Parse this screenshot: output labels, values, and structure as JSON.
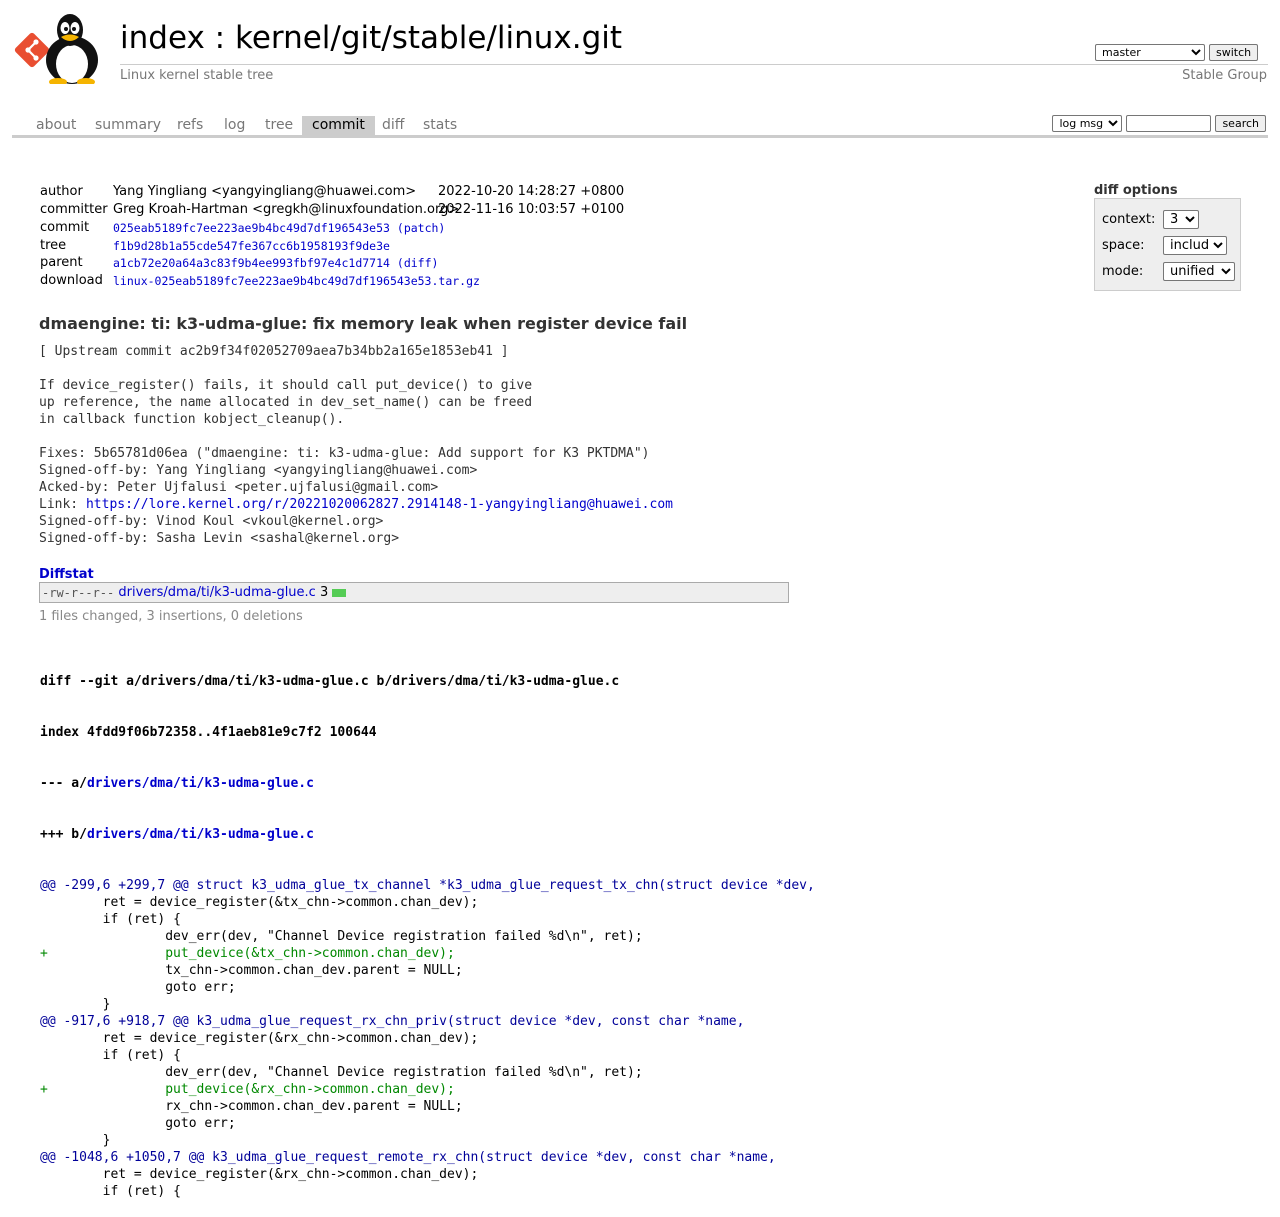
{
  "header": {
    "title_index": "index",
    "title_sep": " : ",
    "title_repo": "kernel/git/stable/linux.git",
    "description": "Linux kernel stable tree",
    "owner": "Stable Group",
    "branch_selected": "master",
    "switch_label": "switch"
  },
  "tabs": [
    "about",
    "summary",
    "refs",
    "log",
    "tree",
    "commit",
    "diff",
    "stats"
  ],
  "active_tab": "commit",
  "search": {
    "type_selected": "log msg",
    "button_label": "search",
    "value": ""
  },
  "diff_options": {
    "title": "diff options",
    "context_label": "context:",
    "context_value": "3",
    "space_label": "space:",
    "space_value": "include",
    "mode_label": "mode:",
    "mode_value": "unified"
  },
  "commit_info": {
    "author_label": "author",
    "author": "Yang Yingliang <yangyingliang@huawei.com>",
    "author_date": "2022-10-20 14:28:27 +0800",
    "committer_label": "committer",
    "committer": "Greg Kroah-Hartman <gregkh@linuxfoundation.org>",
    "committer_date": "2022-11-16 10:03:57 +0100",
    "commit_label": "commit",
    "commit": "025eab5189fc7ee223ae9b4bc49d7df196543e53",
    "commit_extra": "(patch)",
    "tree_label": "tree",
    "tree": "f1b9d28b1a55cde547fe367cc6b1958193f9de3e",
    "parent_label": "parent",
    "parent": "a1cb72e20a64a3c83f9b4ee993fbf97e4c1d7714",
    "parent_extra": "(diff)",
    "download_label": "download",
    "download": "linux-025eab5189fc7ee223ae9b4bc49d7df196543e53.tar.gz"
  },
  "subject": "dmaengine: ti: k3-udma-glue: fix memory leak when register device fail",
  "message_before_link": "[ Upstream commit ac2b9f34f02052709aea7b34bb2a165e1853eb41 ]\n\nIf device_register() fails, it should call put_device() to give\nup reference, the name allocated in dev_set_name() can be freed\nin callback function kobject_cleanup().\n\nFixes: 5b65781d06ea (\"dmaengine: ti: k3-udma-glue: Add support for K3 PKTDMA\")\nSigned-off-by: Yang Yingliang <yangyingliang@huawei.com>\nAcked-by: Peter Ujfalusi <peter.ujfalusi@gmail.com>\nLink: ",
  "message_link": "https://lore.kernel.org/r/20221020062827.2914148-1-yangyingliang@huawei.com",
  "message_after_link": "\nSigned-off-by: Vinod Koul <vkoul@kernel.org>\nSigned-off-by: Sasha Levin <sashal@kernel.org>",
  "diffstat": {
    "title": "Diffstat",
    "mode": "-rw-r--r--",
    "file": "drivers/dma/ti/k3-udma-glue.c",
    "count": "3",
    "summary": "1 files changed, 3 insertions, 0 deletions"
  },
  "diff_header": {
    "line1": "diff --git a/drivers/dma/ti/k3-udma-glue.c b/drivers/dma/ti/k3-udma-glue.c",
    "line2": "index 4fdd9f06b72358..4f1aeb81e9c7f2 100644",
    "minus_prefix": "--- a/",
    "plus_prefix": "+++ b/",
    "path": "drivers/dma/ti/k3-udma-glue.c"
  },
  "diff_lines": [
    {
      "t": "hunk",
      "s": "@@ -299,6 +299,7 @@ struct k3_udma_glue_tx_channel *k3_udma_glue_request_tx_chn(struct device *dev,"
    },
    {
      "t": "ctx",
      "s": " \tret = device_register(&tx_chn->common.chan_dev);"
    },
    {
      "t": "ctx",
      "s": " \tif (ret) {"
    },
    {
      "t": "ctx",
      "s": " \t\tdev_err(dev, \"Channel Device registration failed %d\\n\", ret);"
    },
    {
      "t": "add",
      "s": "+\t\tput_device(&tx_chn->common.chan_dev);"
    },
    {
      "t": "ctx",
      "s": " \t\ttx_chn->common.chan_dev.parent = NULL;"
    },
    {
      "t": "ctx",
      "s": " \t\tgoto err;"
    },
    {
      "t": "ctx",
      "s": " \t}"
    },
    {
      "t": "hunk",
      "s": "@@ -917,6 +918,7 @@ k3_udma_glue_request_rx_chn_priv(struct device *dev, const char *name,"
    },
    {
      "t": "ctx",
      "s": " \tret = device_register(&rx_chn->common.chan_dev);"
    },
    {
      "t": "ctx",
      "s": " \tif (ret) {"
    },
    {
      "t": "ctx",
      "s": " \t\tdev_err(dev, \"Channel Device registration failed %d\\n\", ret);"
    },
    {
      "t": "add",
      "s": "+\t\tput_device(&rx_chn->common.chan_dev);"
    },
    {
      "t": "ctx",
      "s": " \t\trx_chn->common.chan_dev.parent = NULL;"
    },
    {
      "t": "ctx",
      "s": " \t\tgoto err;"
    },
    {
      "t": "ctx",
      "s": " \t}"
    },
    {
      "t": "hunk",
      "s": "@@ -1048,6 +1050,7 @@ k3_udma_glue_request_remote_rx_chn(struct device *dev, const char *name,"
    },
    {
      "t": "ctx",
      "s": " \tret = device_register(&rx_chn->common.chan_dev);"
    },
    {
      "t": "ctx",
      "s": " \tif (ret) {"
    }
  ]
}
